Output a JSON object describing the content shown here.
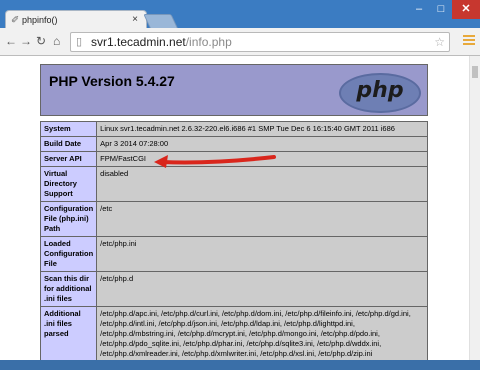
{
  "browser": {
    "tab_title": "phpinfo()",
    "url_host": "svr1.tecadmin.net",
    "url_path": "/info.php",
    "window_controls": {
      "minimize": "–",
      "maximize": "□",
      "close": "✕"
    },
    "icons": {
      "back": "back-arrow-icon",
      "forward": "forward-arrow-icon",
      "reload": "reload-icon",
      "home": "home-icon",
      "star": "star-icon",
      "menu": "menu-icon"
    }
  },
  "page": {
    "header_title": "PHP Version 5.4.27",
    "logo_text": "php",
    "rows": [
      {
        "key": "System",
        "value": "Linux svr1.tecadmin.net 2.6.32-220.el6.i686 #1 SMP Tue Dec 6 16:15:40 GMT 2011 i686"
      },
      {
        "key": "Build Date",
        "value": "Apr 3 2014 07:28:00"
      },
      {
        "key": "Server API",
        "value": "FPM/FastCGI"
      },
      {
        "key": "Virtual Directory Support",
        "value": "disabled"
      },
      {
        "key": "Configuration File (php.ini) Path",
        "value": "/etc"
      },
      {
        "key": "Loaded Configuration File",
        "value": "/etc/php.ini"
      },
      {
        "key": "Scan this dir for additional .ini files",
        "value": "/etc/php.d"
      },
      {
        "key": "Additional .ini files parsed",
        "value": "/etc/php.d/apc.ini, /etc/php.d/curl.ini, /etc/php.d/dom.ini, /etc/php.d/fileinfo.ini, /etc/php.d/gd.ini, /etc/php.d/intl.ini, /etc/php.d/json.ini, /etc/php.d/ldap.ini, /etc/php.d/lighttpd.ini, /etc/php.d/mbstring.ini, /etc/php.d/mcrypt.ini, /etc/php.d/mongo.ini, /etc/php.d/pdo.ini, /etc/php.d/pdo_sqlite.ini, /etc/php.d/phar.ini, /etc/php.d/sqlite3.ini, /etc/php.d/wddx.ini, /etc/php.d/xmlreader.ini, /etc/php.d/xmlwriter.ini, /etc/php.d/xsl.ini, /etc/php.d/zip.ini"
      }
    ]
  }
}
